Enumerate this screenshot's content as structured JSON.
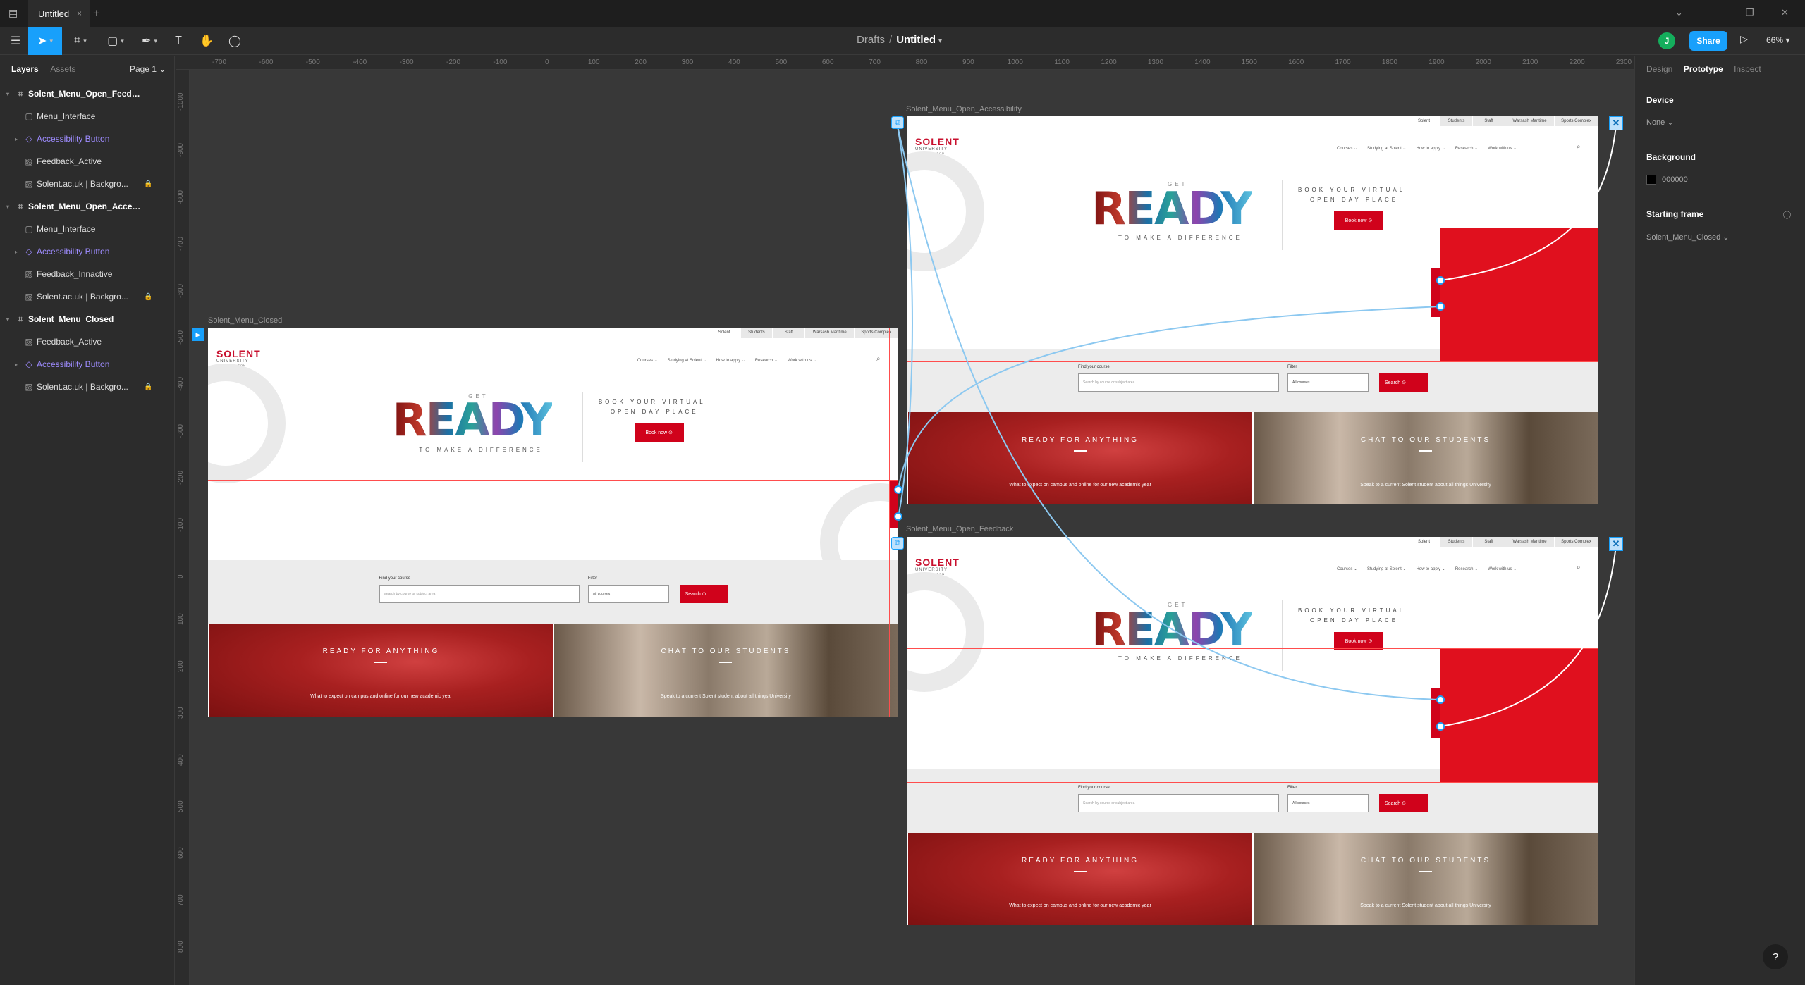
{
  "window": {
    "tab_title": "Untitled",
    "tab_close": "×",
    "new_tab": "+",
    "minimize": "⌄",
    "restore": "❐",
    "close": "✕"
  },
  "toolbar": {
    "breadcrumb_parent": "Drafts",
    "breadcrumb_sep": "/",
    "file_name": "Untitled",
    "avatar_initial": "J",
    "share_label": "Share",
    "zoom": "66%"
  },
  "left_panel": {
    "tab_layers": "Layers",
    "tab_assets": "Assets",
    "page": "Page 1",
    "layers": [
      {
        "label": "Solent_Menu_Open_Feedback",
        "kind": "frame"
      },
      {
        "label": "Menu_Interface",
        "kind": "child"
      },
      {
        "label": "Accessibility Button",
        "kind": "comp"
      },
      {
        "label": "Feedback_Active",
        "kind": "child"
      },
      {
        "label": "Solent.ac.uk | Backgro...",
        "kind": "child",
        "locked": true
      },
      {
        "label": "Solent_Menu_Open_Accessibility",
        "kind": "frame"
      },
      {
        "label": "Menu_Interface",
        "kind": "child"
      },
      {
        "label": "Accessibility Button",
        "kind": "comp"
      },
      {
        "label": "Feedback_Innactive",
        "kind": "child"
      },
      {
        "label": "Solent.ac.uk | Backgro...",
        "kind": "child",
        "locked": true
      },
      {
        "label": "Solent_Menu_Closed",
        "kind": "frame"
      },
      {
        "label": "Feedback_Active",
        "kind": "child"
      },
      {
        "label": "Accessibility Button",
        "kind": "comp"
      },
      {
        "label": "Solent.ac.uk | Backgro...",
        "kind": "child",
        "locked": true
      }
    ]
  },
  "rulers": {
    "h": [
      "-700",
      "-600",
      "-500",
      "-400",
      "-300",
      "-200",
      "-100",
      "0",
      "100",
      "200",
      "300",
      "400",
      "500",
      "600",
      "700",
      "800",
      "900",
      "1000",
      "1100",
      "1200",
      "1300",
      "1400",
      "1500",
      "1600",
      "1700",
      "1800",
      "1900",
      "2000",
      "2100",
      "2200",
      "2300"
    ],
    "v": [
      "-1000",
      "-900",
      "-800",
      "-700",
      "-600",
      "-500",
      "-400",
      "-300",
      "-200",
      "-100",
      "0",
      "100",
      "200",
      "300",
      "400",
      "500",
      "600",
      "700",
      "800"
    ]
  },
  "frames": {
    "closed_label": "Solent_Menu_Closed",
    "accessibility_label": "Solent_Menu_Open_Accessibility",
    "feedback_label": "Solent_Menu_Open_Feedback"
  },
  "site": {
    "top_links": [
      "Solent",
      "Students",
      "Staff",
      "Warsash Maritime",
      "Sports Complex"
    ],
    "logo": "SOLENT",
    "logo_sub": "UNIVERSITY",
    "logo_city": "SOUTHAMPTON",
    "nav": [
      "Courses ⌄",
      "Studying at Solent ⌄",
      "How to apply ⌄",
      "Research ⌄",
      "Work with us ⌄"
    ],
    "hero_get": "GET",
    "hero_ready": "READY",
    "hero_sub": "TO MAKE A DIFFERENCE",
    "book_line1": "BOOK YOUR VIRTUAL",
    "book_line2": "OPEN DAY PLACE",
    "book_btn": "Book now ⊙",
    "find_label": "Find your course",
    "find_placeholder": "Search by course or subject area",
    "filter_label": "Filter",
    "filter_value": "All courses",
    "search_btn": "Search ⊙",
    "card1_title": "READY FOR ANYTHING",
    "card1_sub": "What to expect on campus and online for our new academic year",
    "card2_title": "CHAT TO OUR STUDENTS",
    "card2_sub": "Speak to a current Solent student about all things University"
  },
  "right_panel": {
    "tab_design": "Design",
    "tab_prototype": "Prototype",
    "tab_inspect": "Inspect",
    "device_heading": "Device",
    "device_value": "None ⌄",
    "background_heading": "Background",
    "background_value": "000000",
    "starting_heading": "Starting frame",
    "starting_value": "Solent_Menu_Closed ⌄",
    "help": "?"
  },
  "colors": {
    "accent": "#18a0fb",
    "brand_red": "#d0021b",
    "panel": "#2c2c2c",
    "canvas": "#383838"
  }
}
